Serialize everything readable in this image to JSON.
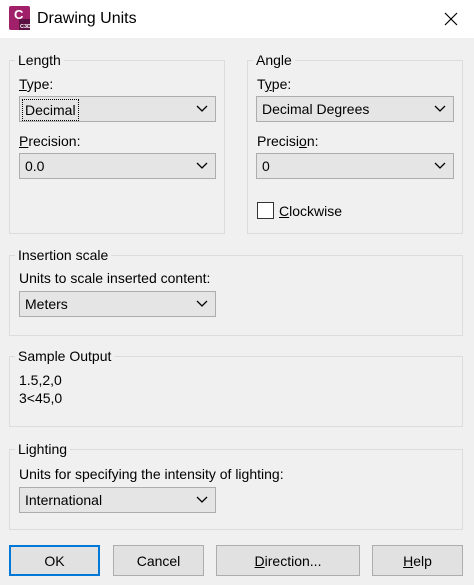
{
  "window": {
    "title": "Drawing Units",
    "app_icon_text": "C",
    "app_icon_subtext": "C3D",
    "app_icon_color": "#a0206a"
  },
  "length": {
    "group_title": "Length",
    "type_label_underline": "T",
    "type_label_rest": "ype:",
    "type_value": "Decimal",
    "precision_label_underline": "P",
    "precision_label_rest": "recision:",
    "precision_value": "0.0"
  },
  "angle": {
    "group_title": "Angle",
    "type_label_pre": "T",
    "type_label_underline": "y",
    "type_label_rest": "pe:",
    "type_value": "Decimal Degrees",
    "precision_label_pre": "Precisi",
    "precision_label_underline": "o",
    "precision_label_rest": "n:",
    "precision_value": "0",
    "clockwise_label_underline": "C",
    "clockwise_label_rest": "lockwise",
    "clockwise_checked": false
  },
  "insertion": {
    "group_title": "Insertion scale",
    "label": "Units to scale inserted content:",
    "value": "Meters"
  },
  "sample": {
    "group_title": "Sample Output",
    "line1": "1.5,2,0",
    "line2": "3<45,0"
  },
  "lighting": {
    "group_title": "Lighting",
    "label": "Units for specifying the intensity of lighting:",
    "value": "International"
  },
  "buttons": {
    "ok": "OK",
    "cancel": "Cancel",
    "direction_underline": "D",
    "direction_rest": "irection...",
    "help_underline": "H",
    "help_rest": "elp"
  },
  "colors": {
    "focus_border": "#0078d7",
    "group_border": "#dcdcdc",
    "dialog_bg": "#f0f0f0"
  }
}
